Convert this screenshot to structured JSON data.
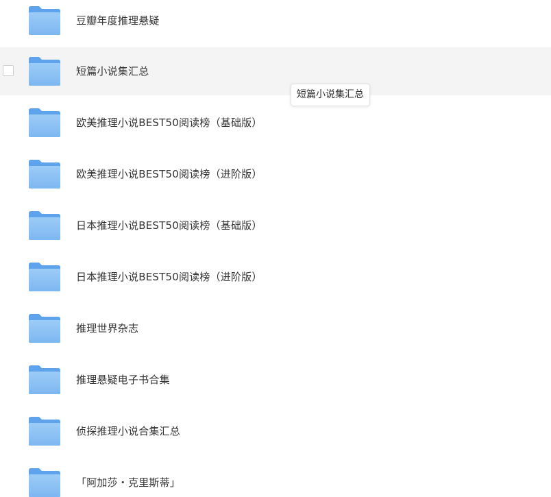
{
  "colors": {
    "folder_back": "#5ea3ec",
    "folder_front_top": "#9cccf7",
    "folder_front_bottom": "#7db7f1",
    "hover_row": "#f4f4f4",
    "text": "#333333"
  },
  "files": [
    {
      "name": "豆瓣年度推理悬疑",
      "icon": "folder-icon"
    },
    {
      "name": "短篇小说集汇总",
      "icon": "folder-icon"
    },
    {
      "name": "欧美推理小说BEST50阅读榜（基础版）",
      "icon": "folder-icon"
    },
    {
      "name": "欧美推理小说BEST50阅读榜（进阶版）",
      "icon": "folder-icon"
    },
    {
      "name": "日本推理小说BEST50阅读榜（基础版）",
      "icon": "folder-icon"
    },
    {
      "name": "日本推理小说BEST50阅读榜（进阶版）",
      "icon": "folder-icon"
    },
    {
      "name": "推理世界杂志",
      "icon": "folder-icon"
    },
    {
      "name": "推理悬疑电子书合集",
      "icon": "folder-icon"
    },
    {
      "name": "侦探推理小说合集汇总",
      "icon": "folder-icon"
    },
    {
      "name": "「阿加莎・克里斯蒂」",
      "icon": "folder-icon"
    }
  ],
  "tooltip": {
    "text": "短篇小说集汇总"
  }
}
